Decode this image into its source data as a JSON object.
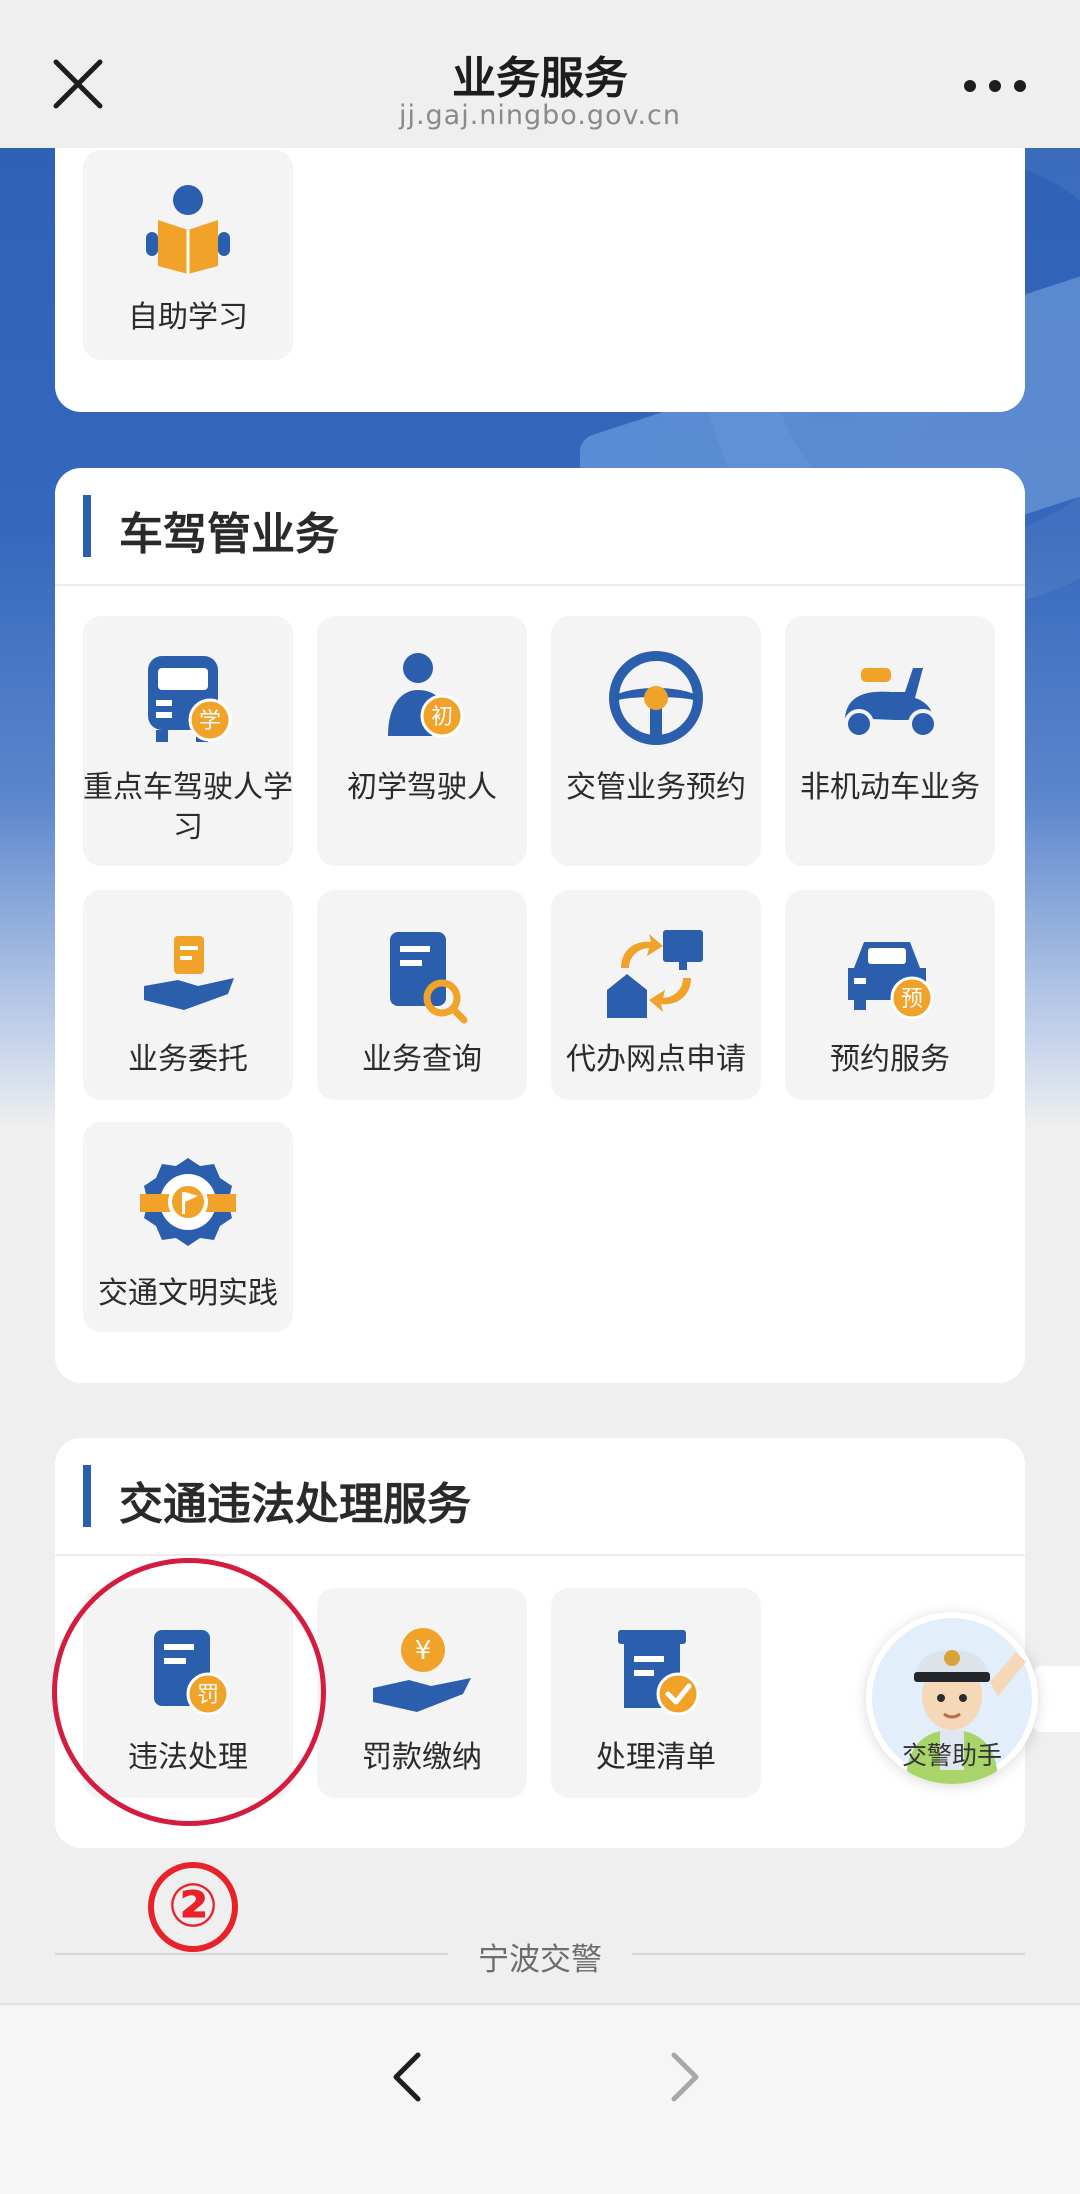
{
  "header": {
    "title": "业务服务",
    "domain": "jj.gaj.ningbo.gov.cn",
    "close_icon": "close-icon",
    "more_icon": "more-icon"
  },
  "top_section": {
    "items": [
      {
        "label": "自助学习",
        "icon": "reading-person-icon"
      }
    ]
  },
  "driver_section": {
    "title": "车驾管业务",
    "items": [
      {
        "label": "重点车驾驶人学习",
        "icon": "bus-study-icon"
      },
      {
        "label": "初学驾驶人",
        "icon": "novice-driver-icon"
      },
      {
        "label": "交管业务预约",
        "icon": "steering-wheel-icon"
      },
      {
        "label": "非机动车业务",
        "icon": "scooter-icon"
      },
      {
        "label": "业务委托",
        "icon": "hand-document-icon"
      },
      {
        "label": "业务查询",
        "icon": "document-search-icon"
      },
      {
        "label": "代办网点申请",
        "icon": "agency-exchange-icon"
      },
      {
        "label": "预约服务",
        "icon": "car-reservation-icon"
      },
      {
        "label": "交通文明实践",
        "icon": "civilization-badge-icon"
      }
    ]
  },
  "violation_section": {
    "title": "交通违法处理服务",
    "items": [
      {
        "label": "违法处理",
        "icon": "document-penalty-icon"
      },
      {
        "label": "罚款缴纳",
        "icon": "yuan-payment-icon"
      },
      {
        "label": "处理清单",
        "icon": "checklist-icon"
      }
    ]
  },
  "annotation": {
    "step": "②"
  },
  "assistant": {
    "label": "交警助手",
    "icon": "police-officer-avatar"
  },
  "footer": {
    "brand": "宁波交警"
  },
  "colors": {
    "primary_blue": "#2f62b7",
    "accent_orange": "#f0a229",
    "annotation_red": "#d41c3f"
  }
}
